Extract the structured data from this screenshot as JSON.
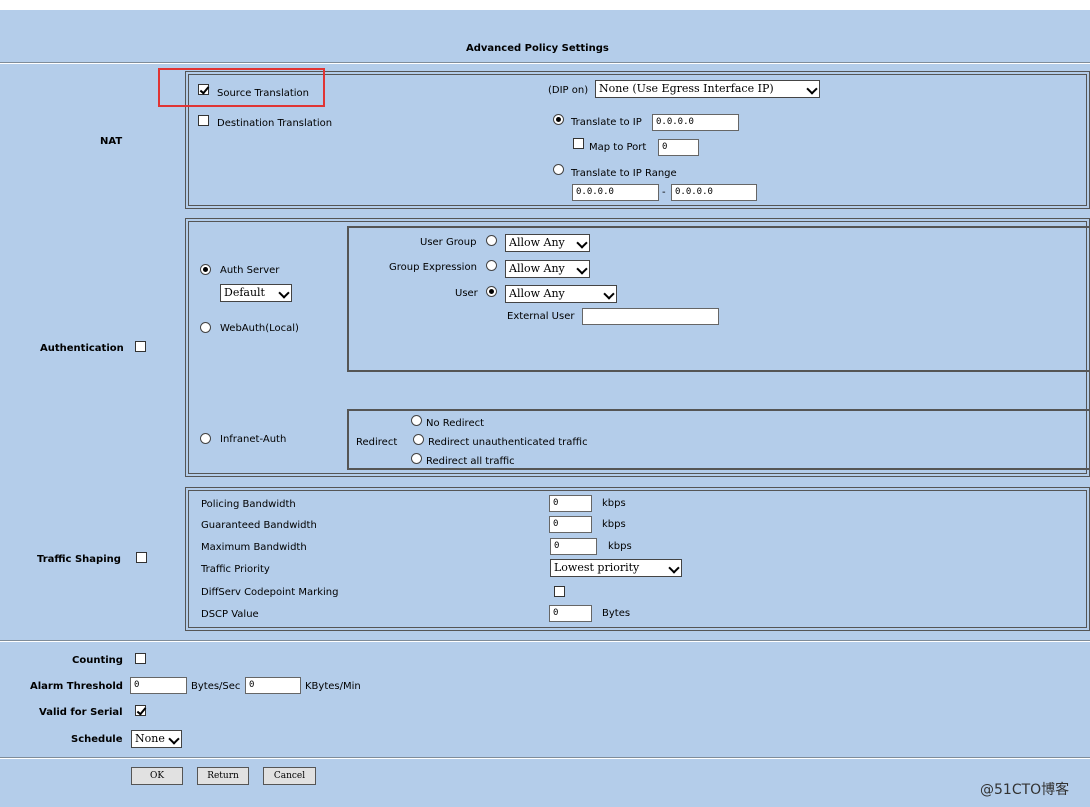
{
  "page_title": "Advanced Policy Settings",
  "nat": {
    "section_label": "NAT",
    "source_translation": {
      "label": "Source Translation",
      "checked": true
    },
    "dip_on_label": "(DIP on)",
    "dip_select": "None (Use Egress Interface IP)",
    "destination_translation": {
      "label": "Destination Translation",
      "checked": false
    },
    "translate_to_ip": {
      "label": "Translate to IP",
      "value": "0.0.0.0",
      "selected": true
    },
    "map_to_port": {
      "label": "Map to Port",
      "value": "0",
      "checked": false
    },
    "translate_to_ip_range": {
      "label": "Translate to IP Range",
      "start": "0.0.0.0",
      "separator": "-",
      "end": "0.0.0.0",
      "selected": false
    }
  },
  "authentication": {
    "section_label": "Authentication",
    "checked": false,
    "auth_server": {
      "label": "Auth Server",
      "selected": true,
      "select_value": "Default"
    },
    "webauth_local": {
      "label": "WebAuth(Local)"
    },
    "infranet_auth": {
      "label": "Infranet-Auth"
    },
    "user_group": {
      "label": "User Group",
      "select_value": "Allow Any"
    },
    "group_expression": {
      "label": "Group Expression",
      "select_value": "Allow Any"
    },
    "user": {
      "label": "User",
      "select_value": "Allow Any"
    },
    "external_user": {
      "label": "External User",
      "value": ""
    },
    "redirect": {
      "label": "Redirect",
      "options": [
        "No Redirect",
        "Redirect unauthenticated traffic",
        "Redirect all traffic"
      ]
    }
  },
  "traffic_shaping": {
    "section_label": "Traffic Shaping",
    "checked": false,
    "policing_bandwidth": {
      "label": "Policing Bandwidth",
      "value": "0",
      "unit": "kbps"
    },
    "guaranteed_bandwidth": {
      "label": "Guaranteed Bandwidth",
      "value": "0",
      "unit": "kbps"
    },
    "maximum_bandwidth": {
      "label": "Maximum Bandwidth",
      "value": "0",
      "unit": "kbps"
    },
    "traffic_priority": {
      "label": "Traffic Priority",
      "select_value": "Lowest priority"
    },
    "diffserv": {
      "label": "DiffServ Codepoint Marking",
      "checked": false
    },
    "dscp_value": {
      "label": "DSCP Value",
      "value": "0",
      "unit": "Bytes"
    }
  },
  "bottom": {
    "counting": {
      "label": "Counting",
      "checked": false
    },
    "alarm_threshold": {
      "label": "Alarm Threshold",
      "bytes_value": "0",
      "bytes_unit": "Bytes/Sec",
      "kbytes_value": "0",
      "kbytes_unit": "KBytes/Min"
    },
    "valid_for_serial": {
      "label": "Valid for Serial",
      "checked": true
    },
    "schedule": {
      "label": "Schedule",
      "select_value": "None"
    }
  },
  "buttons": {
    "ok": "OK",
    "return": "Return",
    "cancel": "Cancel"
  },
  "watermark": "@51CTO博客",
  "colors": {
    "background": "#b4cdea",
    "highlight": "#e03434"
  }
}
